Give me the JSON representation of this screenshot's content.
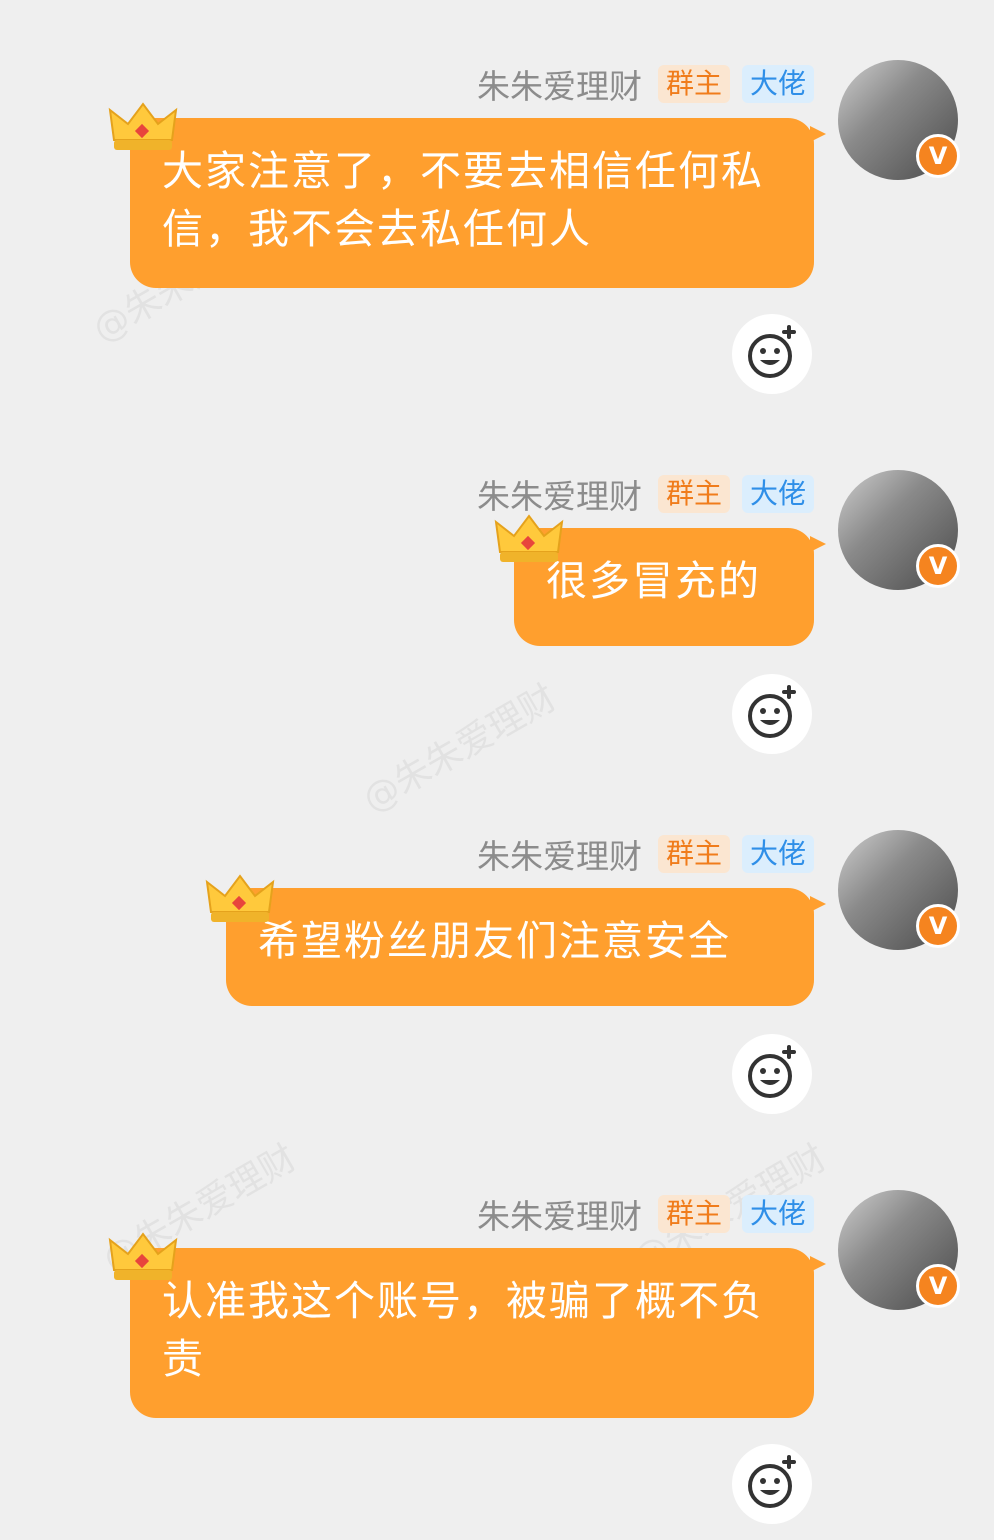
{
  "watermark": "@朱朱爱理财",
  "messages": [
    {
      "name": "朱朱爱理财",
      "tag_owner": "群主",
      "tag_big": "大佬",
      "badge": "V",
      "text": "大家注意了，不要去相信任何私信，我不会去私任何人"
    },
    {
      "name": "朱朱爱理财",
      "tag_owner": "群主",
      "tag_big": "大佬",
      "badge": "V",
      "text": "很多冒充的"
    },
    {
      "name": "朱朱爱理财",
      "tag_owner": "群主",
      "tag_big": "大佬",
      "badge": "V",
      "text": "希望粉丝朋友们注意安全"
    },
    {
      "name": "朱朱爱理财",
      "tag_owner": "群主",
      "tag_big": "大佬",
      "badge": "V",
      "text": "认准我这个账号，被骗了概不负责"
    }
  ],
  "icons": {
    "crown": "crown-icon",
    "react": "add-emoji-reaction-icon",
    "verified": "verified-v-badge"
  },
  "colors": {
    "bubble": "#ff9f2e",
    "owner_tag_text": "#f07c1b",
    "owner_tag_bg": "#fbe6d1",
    "big_tag_text": "#2f8fe8",
    "big_tag_bg": "#dbeefd",
    "name": "#8c8c8c",
    "background": "#efefef"
  }
}
